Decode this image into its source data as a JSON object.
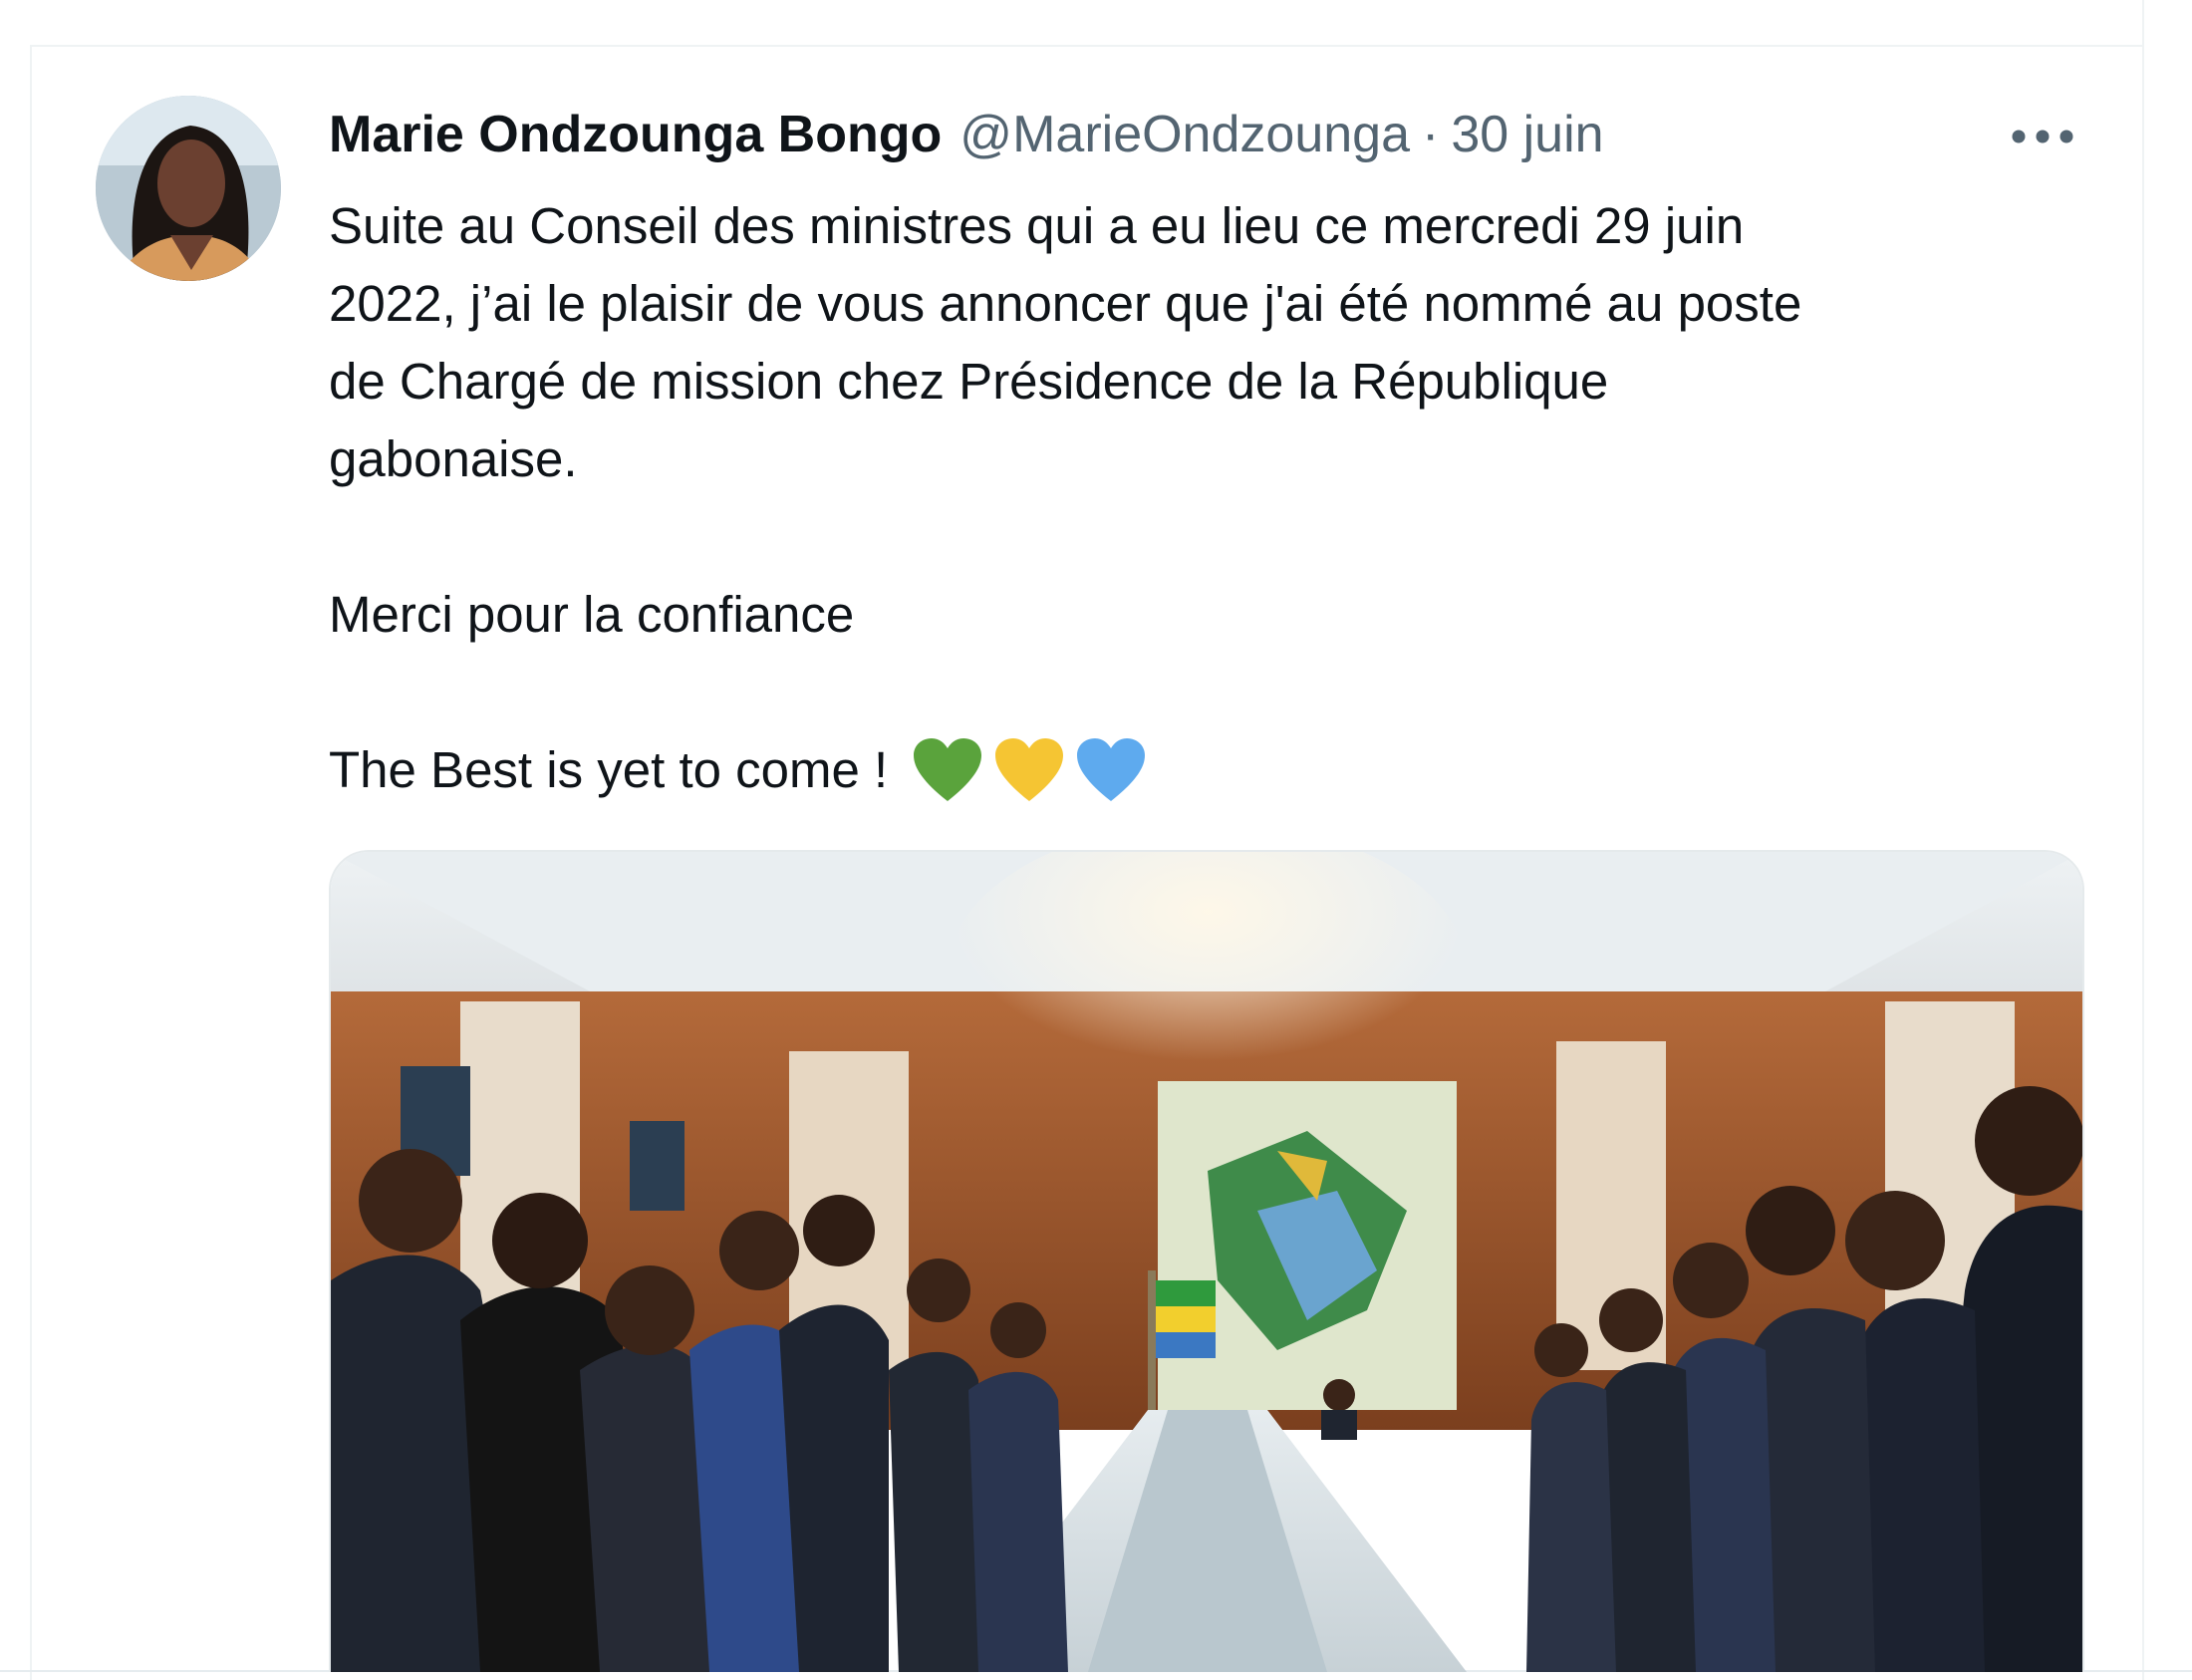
{
  "tweet": {
    "author": {
      "display_name": "Marie Ondzounga Bongo",
      "handle": "@MarieOndzounga",
      "avatar_icon": "profile-photo"
    },
    "separator": "·",
    "date": "30 juin",
    "more_icon": "more-horizontal-icon",
    "text": {
      "paragraph1_line1": "Suite au Conseil des ministres qui a eu lieu ce mercredi 29 juin",
      "paragraph1_line2": "2022, j’ai le plaisir de vous annoncer que j'ai été nommé au poste",
      "paragraph1_line3": "de Chargé de mission chez Présidence de la République",
      "paragraph1_line4": "gabonaise.",
      "paragraph2": "Merci pour la confiance",
      "paragraph3": "The Best is yet to come !"
    },
    "emojis": [
      {
        "name": "green-heart-icon",
        "color": "#5aa33c"
      },
      {
        "name": "yellow-heart-icon",
        "color": "#f5c533"
      },
      {
        "name": "blue-heart-icon",
        "color": "#5eaaee"
      }
    ],
    "media": {
      "type": "photo",
      "subject": "cabinet-meeting-photo"
    }
  },
  "colors": {
    "text_primary": "#0f1419",
    "text_secondary": "#536471",
    "border": "#eff3f4"
  }
}
